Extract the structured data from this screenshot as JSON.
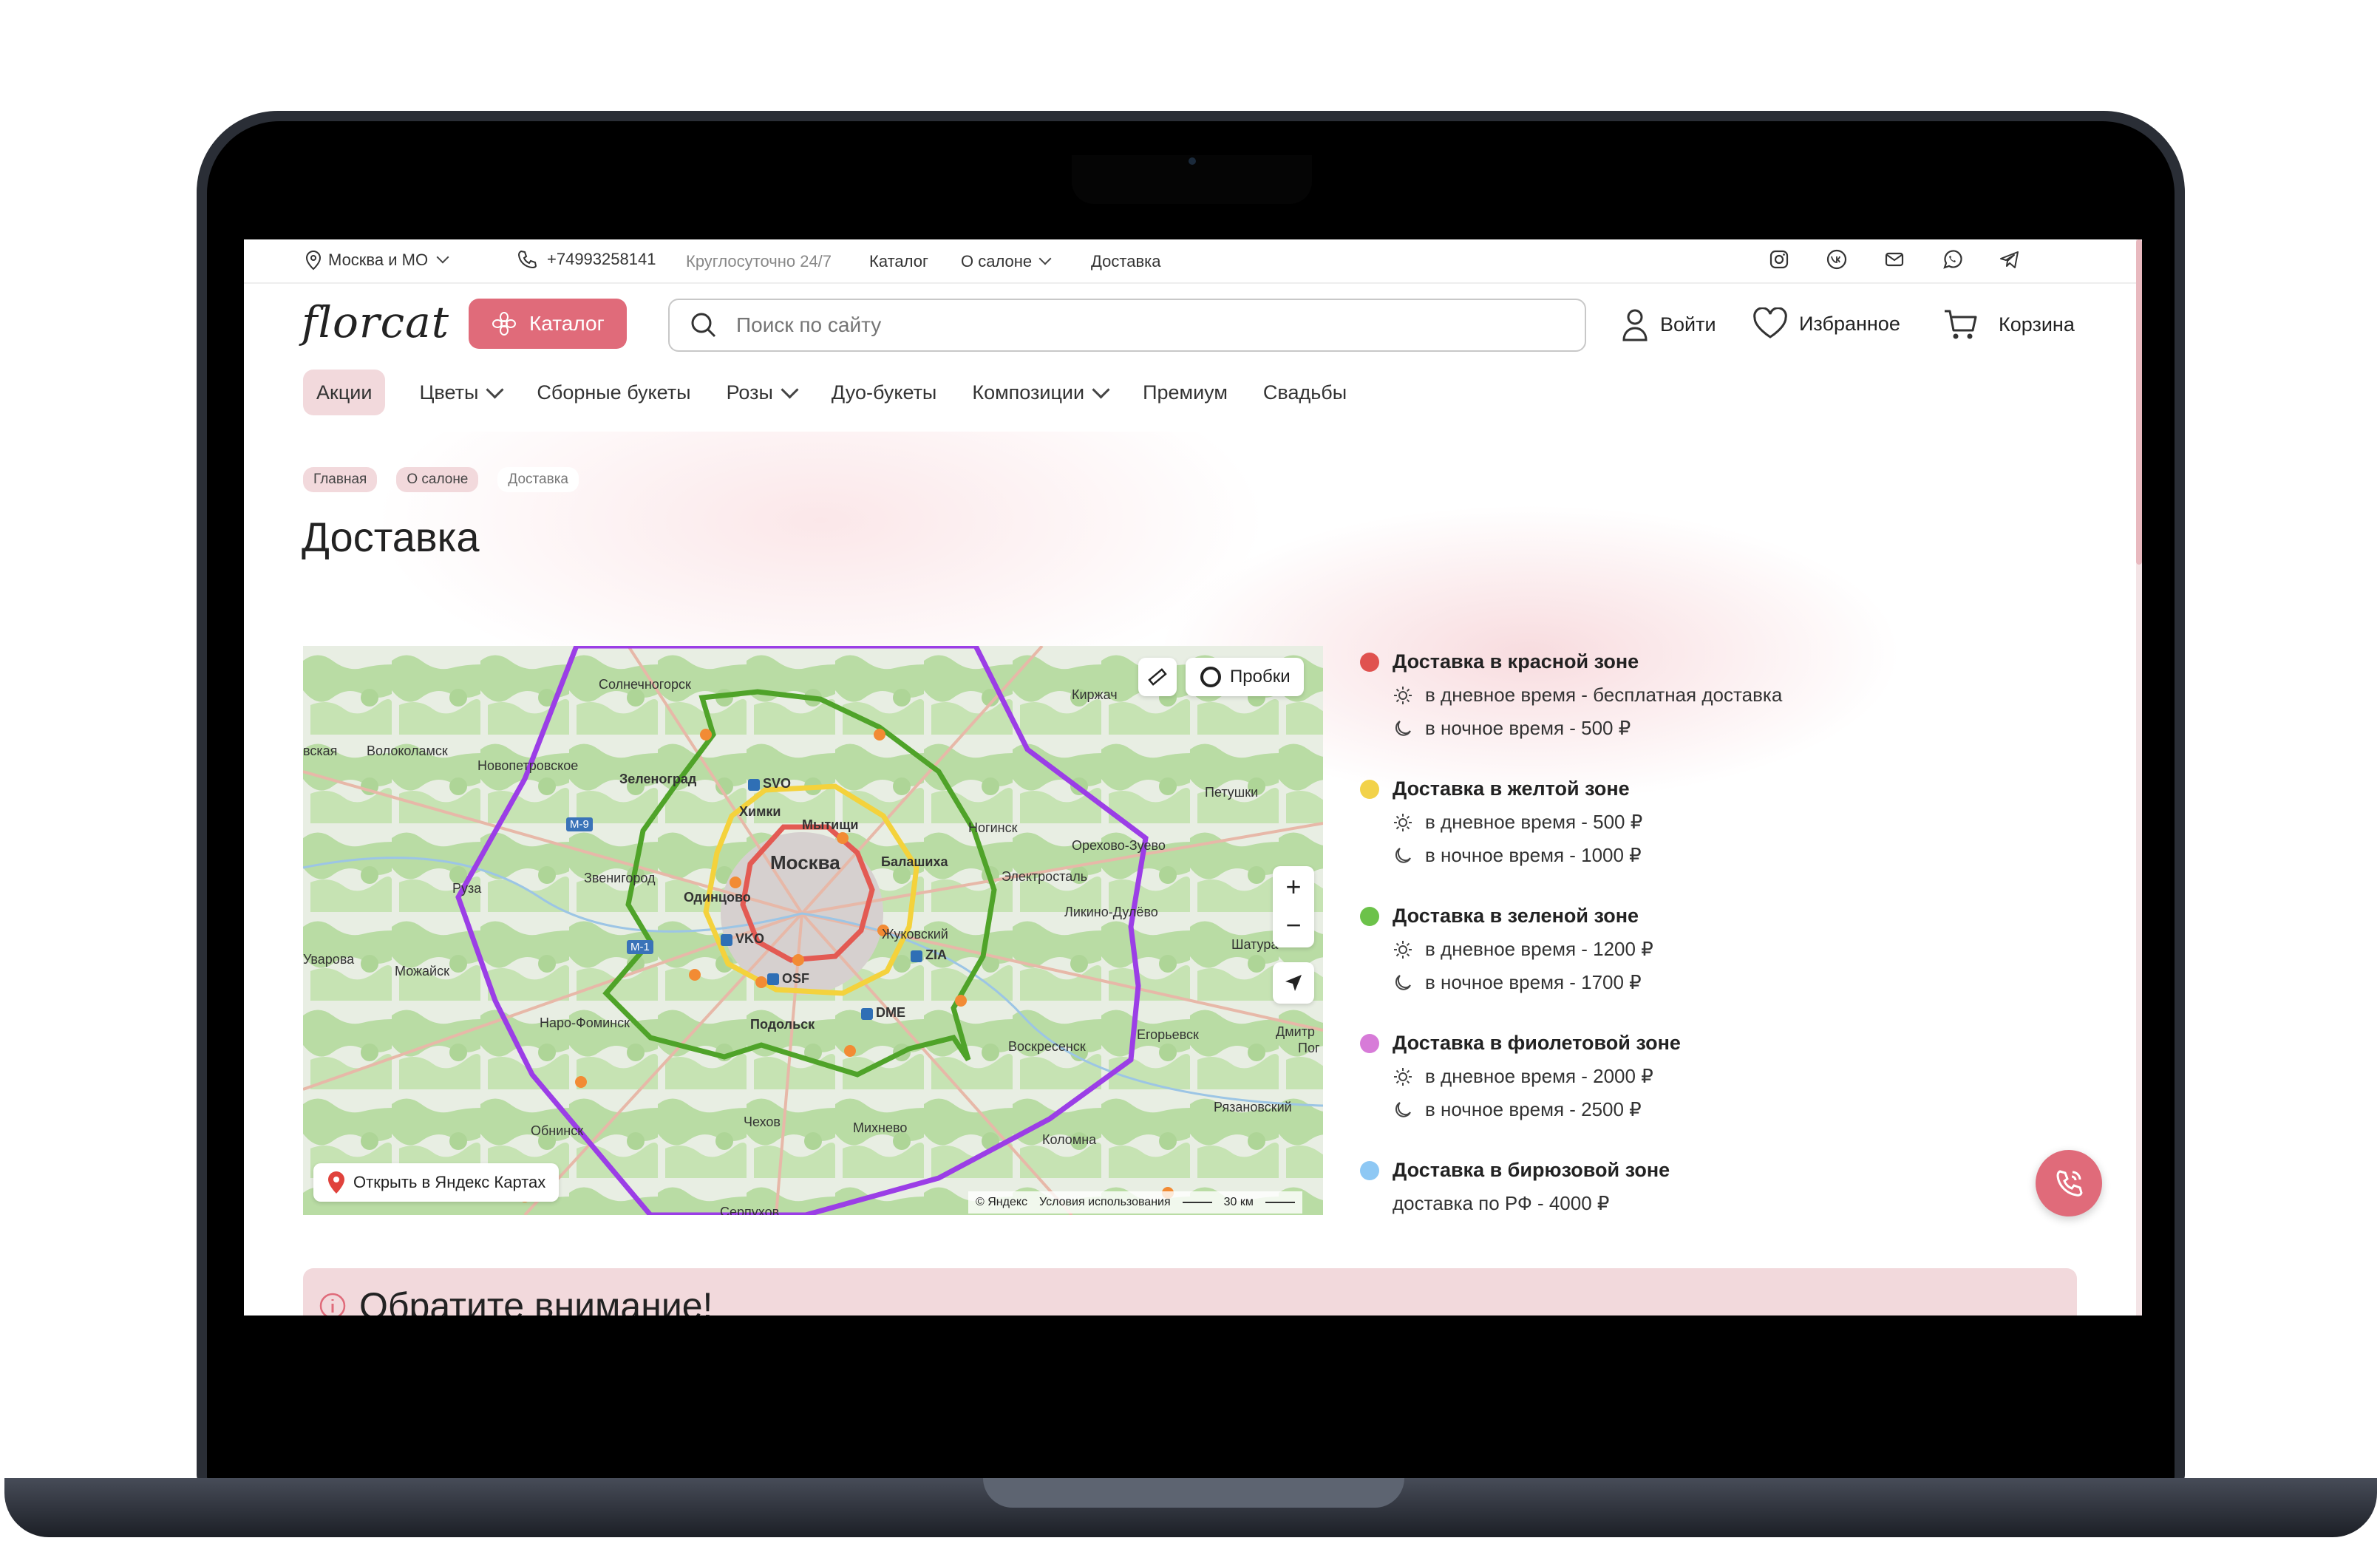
{
  "topbar": {
    "region": "Москва и МО",
    "phone": "+74993258141",
    "hours": "Круглосуточно 24/7",
    "links": [
      "Каталог",
      "О салоне",
      "Доставка"
    ]
  },
  "header": {
    "logo": "florcat",
    "catalog_button": "Каталог",
    "search_placeholder": "Поиск по сайту",
    "login": "Войти",
    "favorites": "Избранное",
    "cart": "Корзина"
  },
  "nav": [
    "Акции",
    "Цветы",
    "Сборные букеты",
    "Розы",
    "Дуо-букеты",
    "Композиции",
    "Премиум",
    "Свадьбы"
  ],
  "breadcrumb": [
    "Главная",
    "О салоне",
    "Доставка"
  ],
  "page_title": "Доставка",
  "map": {
    "traffic": "Пробки",
    "open_link": "Открыть в Яндекс Картах",
    "copyright": "© Яндекс",
    "terms": "Условия использования",
    "scale": "30 км",
    "zoom_in": "+",
    "zoom_out": "−",
    "labels": [
      "Москва",
      "Химки",
      "Мытищи",
      "Балашиха",
      "Одинцово",
      "Жуковский",
      "Подольск",
      "Зеленоград",
      "Солнечногорск",
      "Новопетровское",
      "Волоколамск",
      "Руза",
      "Звенигород",
      "Можайск",
      "Наро-Фоминск",
      "Обнинск",
      "Чехов",
      "Михнево",
      "Коломна",
      "Воскресенск",
      "Егорьевск",
      "Ликино-Дулёво",
      "Орехово-Зуево",
      "Электросталь",
      "Ногинск",
      "Петушки",
      "Киржач",
      "Рязановский",
      "Шатура",
      "Дмитр",
      "Пог",
      "SVO",
      "VKO",
      "OSF",
      "DME",
      "ZIA",
      "М-9",
      "М-1",
      "вская",
      "Уварова",
      "Серпухов"
    ]
  },
  "zones": [
    {
      "title": "Доставка в красной зоне",
      "color": "#e0524f",
      "day": "в дневное время - бесплатная доставка",
      "night": "в ночное время - 500 ₽"
    },
    {
      "title": "Доставка в желтой зоне",
      "color": "#f2d24a",
      "day": "в дневное время - 500 ₽",
      "night": "в ночное время - 1000 ₽"
    },
    {
      "title": "Доставка в зеленой зоне",
      "color": "#6cc24a",
      "day": "в дневное время - 1200 ₽",
      "night": "в ночное время - 1700 ₽"
    },
    {
      "title": "Доставка в фиолетовой зоне",
      "color": "#d77bd8",
      "day": "в дневное время - 2000 ₽",
      "night": "в ночное время - 2500 ₽"
    },
    {
      "title": "Доставка в бирюзовой зоне",
      "color": "#8ec8f4",
      "line": "доставка по РФ - 4000 ₽"
    }
  ],
  "notice_title": "Обратите внимание!"
}
